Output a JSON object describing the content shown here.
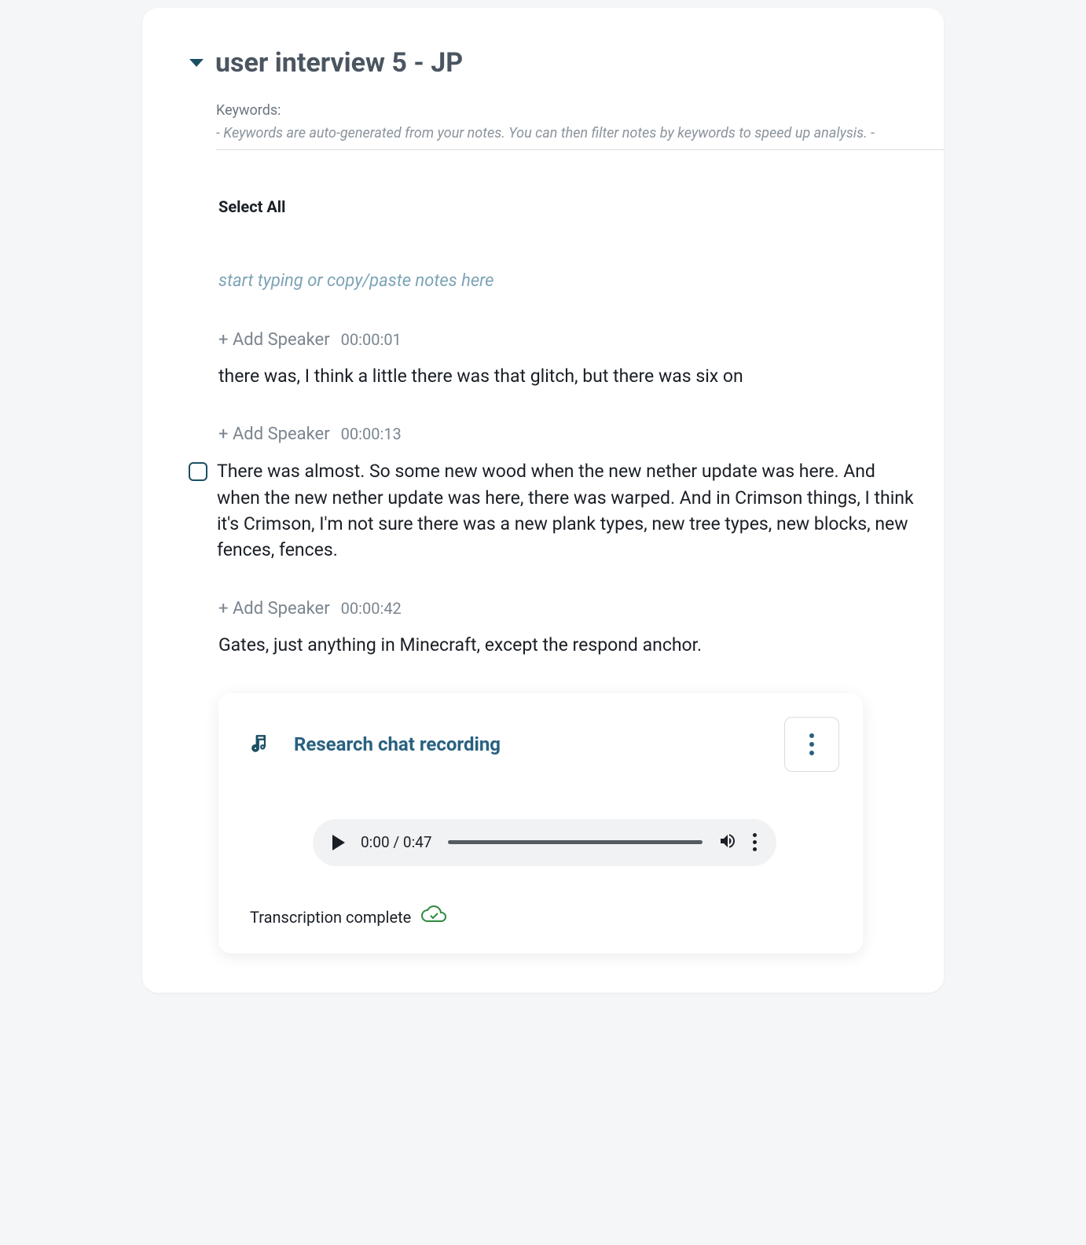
{
  "title": "user interview 5 - JP",
  "keywords": {
    "label": "Keywords:",
    "help": "- Keywords are auto-generated from your notes. You can then filter notes by keywords to speed up analysis. -"
  },
  "select_all": "Select All",
  "notes_placeholder": "start typing or copy/paste notes here",
  "add_speaker_label": "+ Add Speaker",
  "segments": [
    {
      "timestamp": "00:00:01",
      "text": "there was, I think a little there was that glitch, but there was six on",
      "has_checkbox": false
    },
    {
      "timestamp": "00:00:13",
      "text": "There was almost. So some new wood when the new nether update was here. And when the new nether update was here, there was warped. And in Crimson things, I think it's Crimson, I'm not sure there was a new plank types, new tree types, new blocks, new fences, fences.",
      "has_checkbox": true
    },
    {
      "timestamp": "00:00:42",
      "text": "Gates, just anything in Minecraft, except the respond anchor.",
      "has_checkbox": false
    }
  ],
  "audio": {
    "title": "Research chat recording",
    "current_time": "0:00",
    "duration": "0:47",
    "separator": " / ",
    "status": "Transcription complete"
  }
}
